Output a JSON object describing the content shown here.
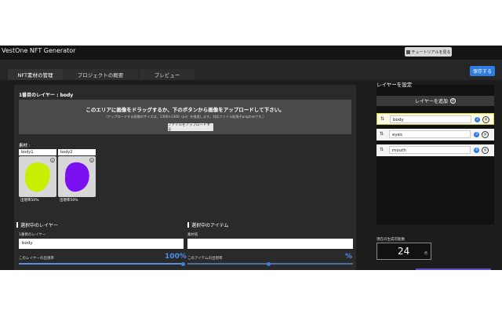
{
  "app": {
    "title": "VestOne NFT Generator",
    "tutorial_label": "チュートリアルを見る"
  },
  "tabs": [
    {
      "label": "NFT素材の管理"
    },
    {
      "label": "プロジェクトの概要"
    },
    {
      "label": "プレビュー"
    }
  ],
  "save_label": "保存する",
  "main": {
    "layer_title": "1番目のレイヤー : body",
    "drop_main": "このエリアに画像をドラッグするか、下のボタンから画像をアップロードして下さい。",
    "drop_sub": "（アップロードする画像のサイズは、1300×1300（px）を推奨します。対応ファイル拡張子pngのみです。）",
    "upload_label": "ファイルをアップロードする",
    "materials_title": "素材 :",
    "materials": [
      {
        "name": "body1",
        "rate_text": "出現率50%",
        "color": "#c8ee00"
      },
      {
        "name": "body2",
        "rate_text": "出現率50%",
        "color": "#7a10f0"
      }
    ]
  },
  "bottom": {
    "layer_section": "選択中のレイヤー",
    "layer_field_label": "1番目のレイヤー",
    "layer_value": "body",
    "layer_rate_label": "このレイヤーの出現率",
    "layer_rate_pct": "100%",
    "item_section": "選択中のアイテム",
    "item_field_label": "素材名",
    "item_value": "",
    "item_rate_label": "このアイテムの出現率",
    "item_rate_pct": "%"
  },
  "right": {
    "title": "レイヤーを設定",
    "add_label": "レイヤーを追加",
    "layers": [
      {
        "name": "body",
        "count": "2"
      },
      {
        "name": "eyes",
        "count": "3"
      },
      {
        "name": "mouth",
        "count": "4"
      }
    ],
    "generate_label": "現在の生成可能数",
    "generate_count": "24",
    "generate_unit": "点"
  }
}
